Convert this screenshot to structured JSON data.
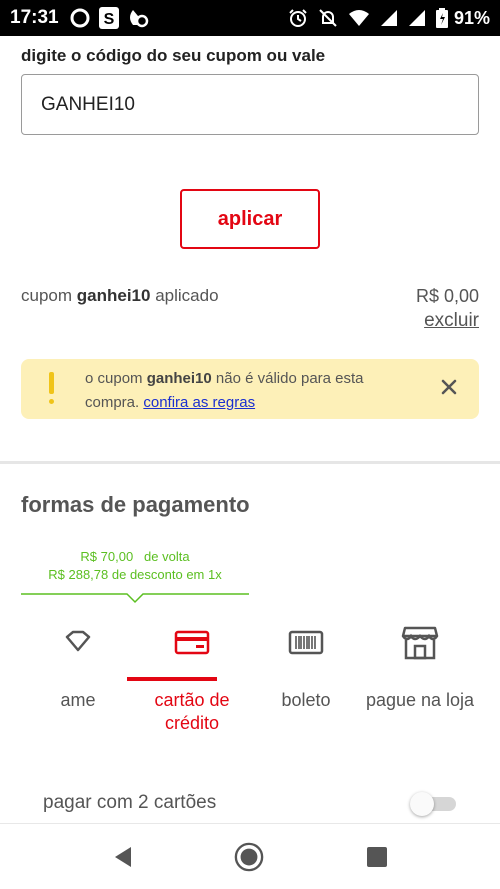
{
  "status_bar": {
    "time": "17:31",
    "battery": "91%"
  },
  "coupon": {
    "label": "digite o código do seu cupom ou vale",
    "value": "GANHEI10",
    "apply_label": "aplicar",
    "applied_prefix": "cupom",
    "applied_code": "ganhei10",
    "applied_suffix": "aplicado",
    "applied_value": "R$ 0,00",
    "remove_label": "excluir"
  },
  "warning": {
    "prefix": "o cupom",
    "code": "ganhei10",
    "suffix": "não é válido para esta compra.",
    "link": "confira as regras"
  },
  "payment": {
    "title": "formas de pagamento",
    "promo_line1_amount": "R$ 70,00",
    "promo_line1_text": "de volta",
    "promo_line2": "R$ 288,78 de desconto em 1x",
    "options": [
      {
        "label": "ame",
        "icon": "diamond-icon"
      },
      {
        "label": "cartão de crédito",
        "icon": "credit-card-icon",
        "selected": true
      },
      {
        "label": "boleto",
        "icon": "barcode-icon"
      },
      {
        "label": "pague na loja",
        "icon": "store-icon"
      }
    ],
    "two_cards_label": "pagar com 2 cartões",
    "two_cards_enabled": false
  },
  "colors": {
    "accent": "#e30613",
    "promo_green": "#5bbf21",
    "warning_bg": "#fdf0b8"
  }
}
